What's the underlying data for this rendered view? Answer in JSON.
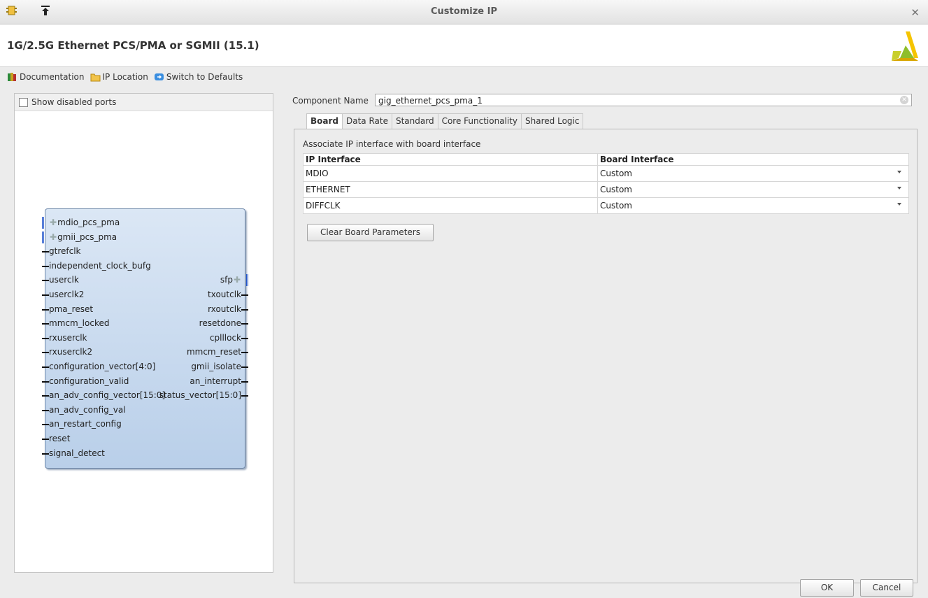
{
  "window": {
    "title": "Customize IP"
  },
  "header": {
    "ip_name": "1G/2.5G Ethernet PCS/PMA or SGMII (15.1)"
  },
  "toolbar": {
    "documentation": "Documentation",
    "ip_location": "IP Location",
    "switch_defaults": "Switch to Defaults"
  },
  "left": {
    "show_disabled_ports": "Show disabled ports",
    "left_ports": [
      {
        "label": "mdio_pcs_pma",
        "bus": true
      },
      {
        "label": "gmii_pcs_pma",
        "bus": true
      },
      {
        "label": "gtrefclk",
        "bus": false
      },
      {
        "label": "independent_clock_bufg",
        "bus": false
      },
      {
        "label": "userclk",
        "bus": false
      },
      {
        "label": "userclk2",
        "bus": false
      },
      {
        "label": "pma_reset",
        "bus": false
      },
      {
        "label": "mmcm_locked",
        "bus": false
      },
      {
        "label": "rxuserclk",
        "bus": false
      },
      {
        "label": "rxuserclk2",
        "bus": false
      },
      {
        "label": "configuration_vector[4:0]",
        "bus": false
      },
      {
        "label": "configuration_valid",
        "bus": false
      },
      {
        "label": "an_adv_config_vector[15:0]",
        "bus": false
      },
      {
        "label": "an_adv_config_val",
        "bus": false
      },
      {
        "label": "an_restart_config",
        "bus": false
      },
      {
        "label": "reset",
        "bus": false
      },
      {
        "label": "signal_detect",
        "bus": false
      }
    ],
    "right_ports": [
      {
        "label": "sfp",
        "bus": true
      },
      {
        "label": "txoutclk",
        "bus": false
      },
      {
        "label": "rxoutclk",
        "bus": false
      },
      {
        "label": "resetdone",
        "bus": false
      },
      {
        "label": "cplllock",
        "bus": false
      },
      {
        "label": "mmcm_reset",
        "bus": false
      },
      {
        "label": "gmii_isolate",
        "bus": false
      },
      {
        "label": "an_interrupt",
        "bus": false
      },
      {
        "label": "status_vector[15:0]",
        "bus": false
      }
    ]
  },
  "component": {
    "label": "Component Name",
    "value": "gig_ethernet_pcs_pma_1"
  },
  "tabs": [
    "Board",
    "Data Rate",
    "Standard",
    "Core Functionality",
    "Shared Logic"
  ],
  "board": {
    "assoc_label": "Associate IP interface with board interface",
    "col_ip": "IP Interface",
    "col_board": "Board Interface",
    "rows": [
      {
        "ip": "MDIO",
        "board": "Custom"
      },
      {
        "ip": "ETHERNET",
        "board": "Custom"
      },
      {
        "ip": "DIFFCLK",
        "board": "Custom"
      }
    ],
    "clear_button": "Clear Board Parameters"
  },
  "footer": {
    "ok": "OK",
    "cancel": "Cancel"
  }
}
